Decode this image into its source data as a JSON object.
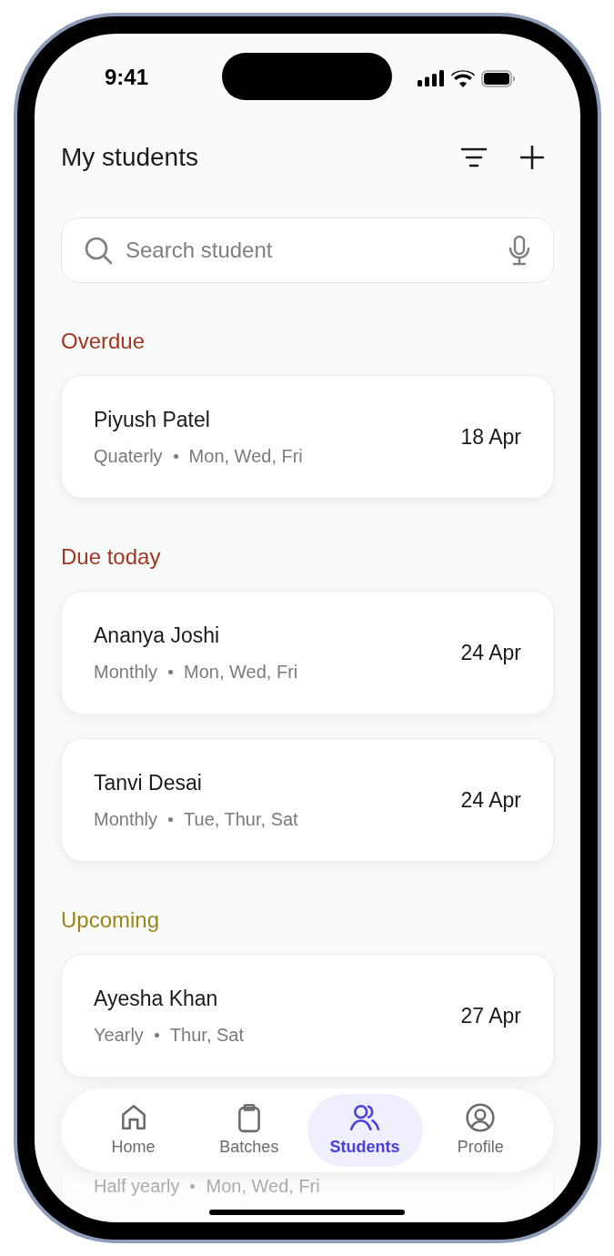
{
  "status_bar": {
    "time": "9:41"
  },
  "header": {
    "title": "My students"
  },
  "search": {
    "placeholder": "Search student"
  },
  "sections": [
    {
      "title": "Overdue",
      "color": "#a2351f",
      "students": [
        {
          "name": "Piyush Patel",
          "plan": "Quaterly",
          "days": "Mon, Wed, Fri",
          "date": "18 Apr"
        }
      ]
    },
    {
      "title": "Due today",
      "color": "#a2351f",
      "students": [
        {
          "name": "Ananya Joshi",
          "plan": "Monthly",
          "days": "Mon, Wed, Fri",
          "date": "24 Apr"
        },
        {
          "name": "Tanvi Desai",
          "plan": "Monthly",
          "days": "Tue, Thur, Sat",
          "date": "24 Apr"
        }
      ]
    },
    {
      "title": "Upcoming",
      "color": "#9a8518",
      "students": [
        {
          "name": "Ayesha Khan",
          "plan": "Yearly",
          "days": "Thur, Sat",
          "date": "27 Apr"
        },
        {
          "plan": "Half yearly",
          "days": "Mon, Wed, Fri"
        }
      ]
    }
  ],
  "nav": [
    {
      "label": "Home",
      "kind": "home",
      "selected": false
    },
    {
      "label": "Batches",
      "kind": "clipboard",
      "selected": false
    },
    {
      "label": "Students",
      "kind": "users",
      "selected": true
    },
    {
      "label": "Profile",
      "kind": "profile",
      "selected": false
    }
  ]
}
